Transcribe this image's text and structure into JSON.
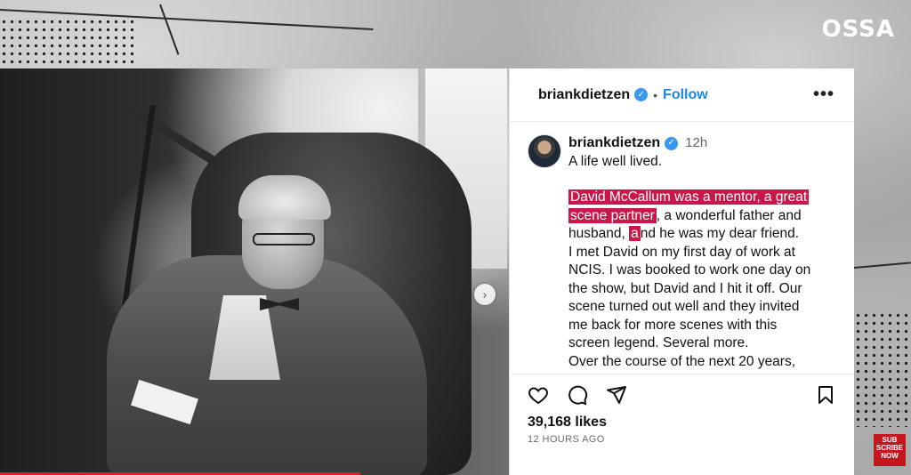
{
  "brand": {
    "logo_text": "OSSA"
  },
  "subscribe": {
    "line1": "SUB",
    "line2": "SCRIBE",
    "line3": "NOW"
  },
  "post": {
    "header": {
      "username": "briankdietzen",
      "separator": "•",
      "follow_label": "Follow",
      "more_label": "•••"
    },
    "caption": {
      "username": "briankdietzen",
      "time": "12h",
      "line_intro": "A life well lived.",
      "highlight_1": "David McCallum was a mentor, a great",
      "highlight_2": "scene partner",
      "text_after_highlight": ", a wonderful father and",
      "text_husband": "husband, ",
      "highlight_3": "a",
      "text_after_a": "nd he was my dear friend.",
      "paragraph": [
        "I met David on my first day of work at",
        "NCIS. I was booked to work one day on",
        "the show, but David and I hit it off. Our",
        "scene turned out well and they invited",
        "me back for more scenes with this",
        "screen legend. Several more.",
        "Over the course of the next 20 years,"
      ]
    },
    "likes": "39,168 likes",
    "time_ago": "12 HOURS AGO"
  },
  "icons": {
    "like": "heart-icon",
    "comment": "comment-icon",
    "share": "share-icon",
    "save": "bookmark-icon",
    "next": "chevron-right-icon"
  },
  "colors": {
    "follow": "#1b87e6",
    "highlight": "#c9174a",
    "verified": "#3897f0",
    "subscribe": "#c4161c"
  }
}
